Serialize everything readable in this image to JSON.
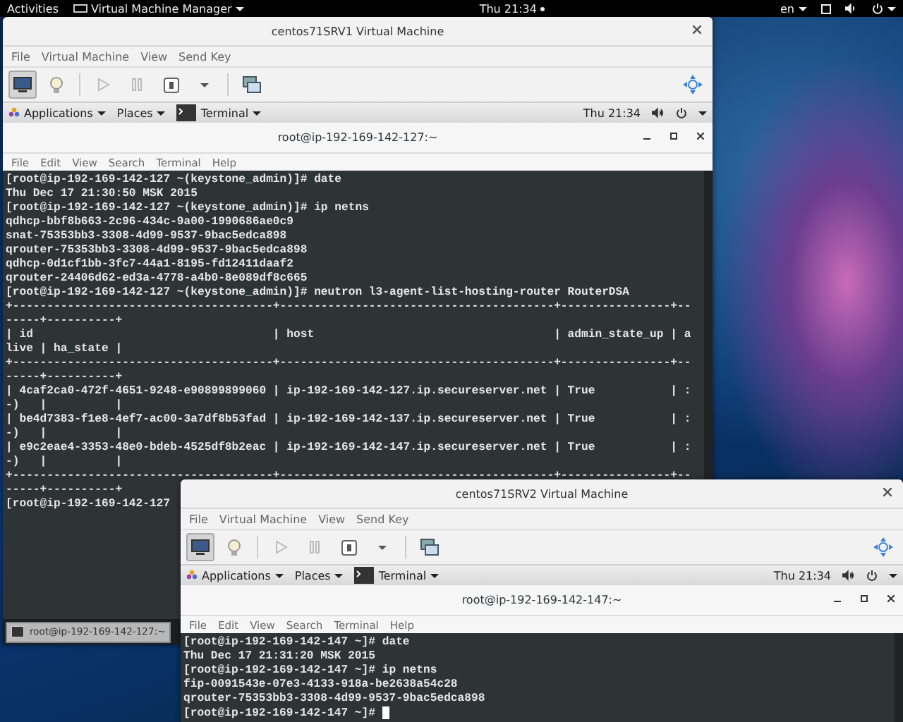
{
  "top_bar": {
    "activities": "Activities",
    "app_menu": "Virtual Machine Manager",
    "clock": "Thu 21:34",
    "language": "en"
  },
  "vm_windows": [
    {
      "title": "centos71SRV1 Virtual Machine",
      "menu": [
        "File",
        "Virtual Machine",
        "View",
        "Send Key"
      ],
      "toolbar": [
        {
          "kind": "console",
          "selected": true
        },
        {
          "kind": "details",
          "selected": false
        },
        {
          "kind": "run",
          "selected": false
        },
        {
          "kind": "pause",
          "selected": false
        },
        {
          "kind": "shutdown",
          "selected": false
        },
        {
          "kind": "menu",
          "selected": false
        },
        {
          "kind": "screenshot",
          "selected": false
        },
        {
          "kind": "fullscreen",
          "selected": false
        }
      ],
      "guest_panel": {
        "applications": "Applications",
        "places": "Places",
        "task": "Terminal",
        "clock": "Thu 21:34"
      },
      "terminal": {
        "title": "root@ip-192-169-142-127:~",
        "menu": [
          "File",
          "Edit",
          "View",
          "Search",
          "Terminal",
          "Help"
        ],
        "lines": [
          "[root@ip-192-169-142-127 ~(keystone_admin)]# date",
          "Thu Dec 17 21:30:50 MSK 2015",
          "[root@ip-192-169-142-127 ~(keystone_admin)]# ip netns",
          "qdhcp-bbf8b663-2c96-434c-9a00-1990686ae0c9",
          "snat-75353bb3-3308-4d99-9537-9bac5edca898",
          "qrouter-75353bb3-3308-4d99-9537-9bac5edca898",
          "qdhcp-0d1cf1bb-3fc7-44a1-8195-fd12411daaf2",
          "qrouter-24406d62-ed3a-4778-a4b0-8e089df8c665",
          "[root@ip-192-169-142-127 ~(keystone_admin)]# neutron l3-agent-list-hosting-router RouterDSA",
          "+--------------------------------------+----------------------------------------+----------------+--",
          "-----+----------+",
          "| id                                   | host                                   | admin_state_up | a",
          "live | ha_state |",
          "+--------------------------------------+----------------------------------------+----------------+--",
          "-----+----------+",
          "| 4caf2ca0-472f-4651-9248-e90899899060 | ip-192-169-142-127.ip.secureserver.net | True           | :",
          "-)   |          |",
          "| be4d7383-f1e8-4ef7-ac00-3a7df8b53fad | ip-192-169-142-137.ip.secureserver.net | True           | :",
          "-)   |          |",
          "| e9c2eae4-3353-48e0-bdeb-4525df8b2eac | ip-192-169-142-147.ip.secureserver.net | True           | :",
          "-)   |          |",
          "+--------------------------------------+----------------------------------------+----------------+--",
          "-----+----------+",
          "[root@ip-192-169-142-127"
        ]
      },
      "bottom_panel": {
        "task": "root@ip-192-169-142-127:~"
      }
    },
    {
      "title": "centos71SRV2 Virtual Machine",
      "menu": [
        "File",
        "Virtual Machine",
        "View",
        "Send Key"
      ],
      "toolbar": [
        {
          "kind": "console",
          "selected": true
        },
        {
          "kind": "details",
          "selected": false
        },
        {
          "kind": "run",
          "selected": false
        },
        {
          "kind": "pause",
          "selected": false
        },
        {
          "kind": "shutdown",
          "selected": false
        },
        {
          "kind": "menu",
          "selected": false
        },
        {
          "kind": "screenshot",
          "selected": false
        },
        {
          "kind": "fullscreen",
          "selected": false
        }
      ],
      "guest_panel": {
        "applications": "Applications",
        "places": "Places",
        "task": "Terminal",
        "clock": "Thu 21:34"
      },
      "terminal": {
        "title": "root@ip-192-169-142-147:~",
        "menu": [
          "File",
          "Edit",
          "View",
          "Search",
          "Terminal",
          "Help"
        ],
        "lines": [
          "[root@ip-192-169-142-147 ~]# date",
          "Thu Dec 17 21:31:20 MSK 2015",
          "[root@ip-192-169-142-147 ~]# ip netns",
          "fip-0091543e-07e3-4133-918a-be2638a54c28",
          "qrouter-75353bb3-3308-4d99-9537-9bac5edca898",
          "[root@ip-192-169-142-147 ~]# "
        ]
      }
    }
  ]
}
